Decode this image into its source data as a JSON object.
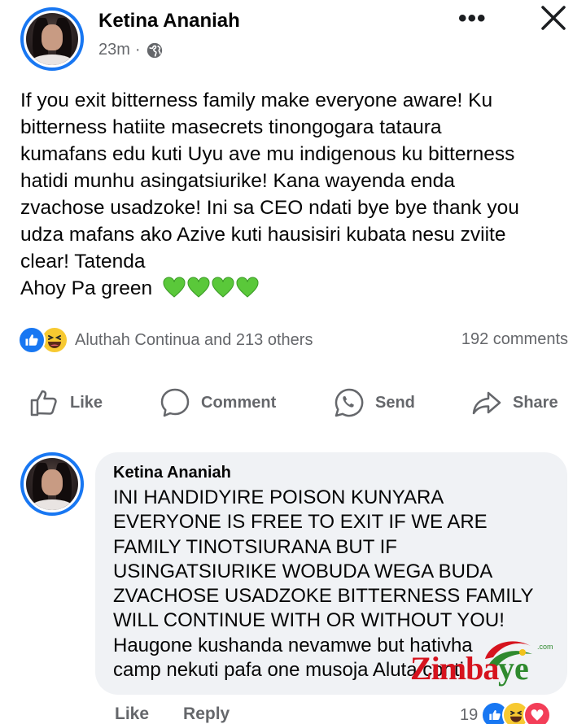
{
  "post": {
    "author": "Ketina Ananiah",
    "time": "23m",
    "separator": "·",
    "body_lines": [
      "If you exit bitterness family make everyone aware! Ku",
      "bitterness hatiite masecrets tinongogara tataura",
      "kumafans edu kuti Uyu ave mu indigenous ku bitterness",
      "hatidi munhu asingatsiurike! Kana wayenda enda",
      "zvachose usadzoke! Ini sa CEO ndati bye bye thank you",
      "udza mafans ako Azive kuti hausisiri kubata nesu zviite",
      "clear! Tatenda"
    ],
    "last_line": "Ahoy Pa green",
    "reactions_text": "Aluthah Continua and 213 others",
    "comments_count": "192 comments"
  },
  "actions": {
    "like": "Like",
    "comment": "Comment",
    "send": "Send",
    "share": "Share"
  },
  "comment": {
    "author": "Ketina Ananiah",
    "lines": [
      "INI HANDIDYIRE POISON KUNYARA",
      "EVERYONE IS FREE TO EXIT IF WE ARE",
      "FAMILY TINOTSIURANA BUT IF",
      "USINGATSIURIKE WOBUDA WEGA BUDA",
      "ZVACHOSE USADZOKE BITTERNESS FAMILY",
      "WILL CONTINUE WITH OR WITHOUT YOU!",
      "Haugone kushanda nevamwe but hativha",
      "camp nekuti pafa one musoja Aluta conti"
    ],
    "like": "Like",
    "reply": "Reply",
    "reaction_count": "19"
  },
  "watermark": {
    "part1": "Zimba",
    "part2": "ye",
    "suffix": ".com"
  },
  "colors": {
    "accent": "#1877f2",
    "meta_gray": "#65676b",
    "bubble_bg": "#f0f2f5",
    "heart_green": "#5ac83a"
  },
  "icons": [
    "globe-icon",
    "more-icon",
    "close-icon",
    "like-reaction-icon",
    "haha-reaction-icon",
    "love-reaction-icon",
    "thumbs-up-icon",
    "comment-icon",
    "whatsapp-send-icon",
    "share-icon",
    "green-heart-icon"
  ]
}
